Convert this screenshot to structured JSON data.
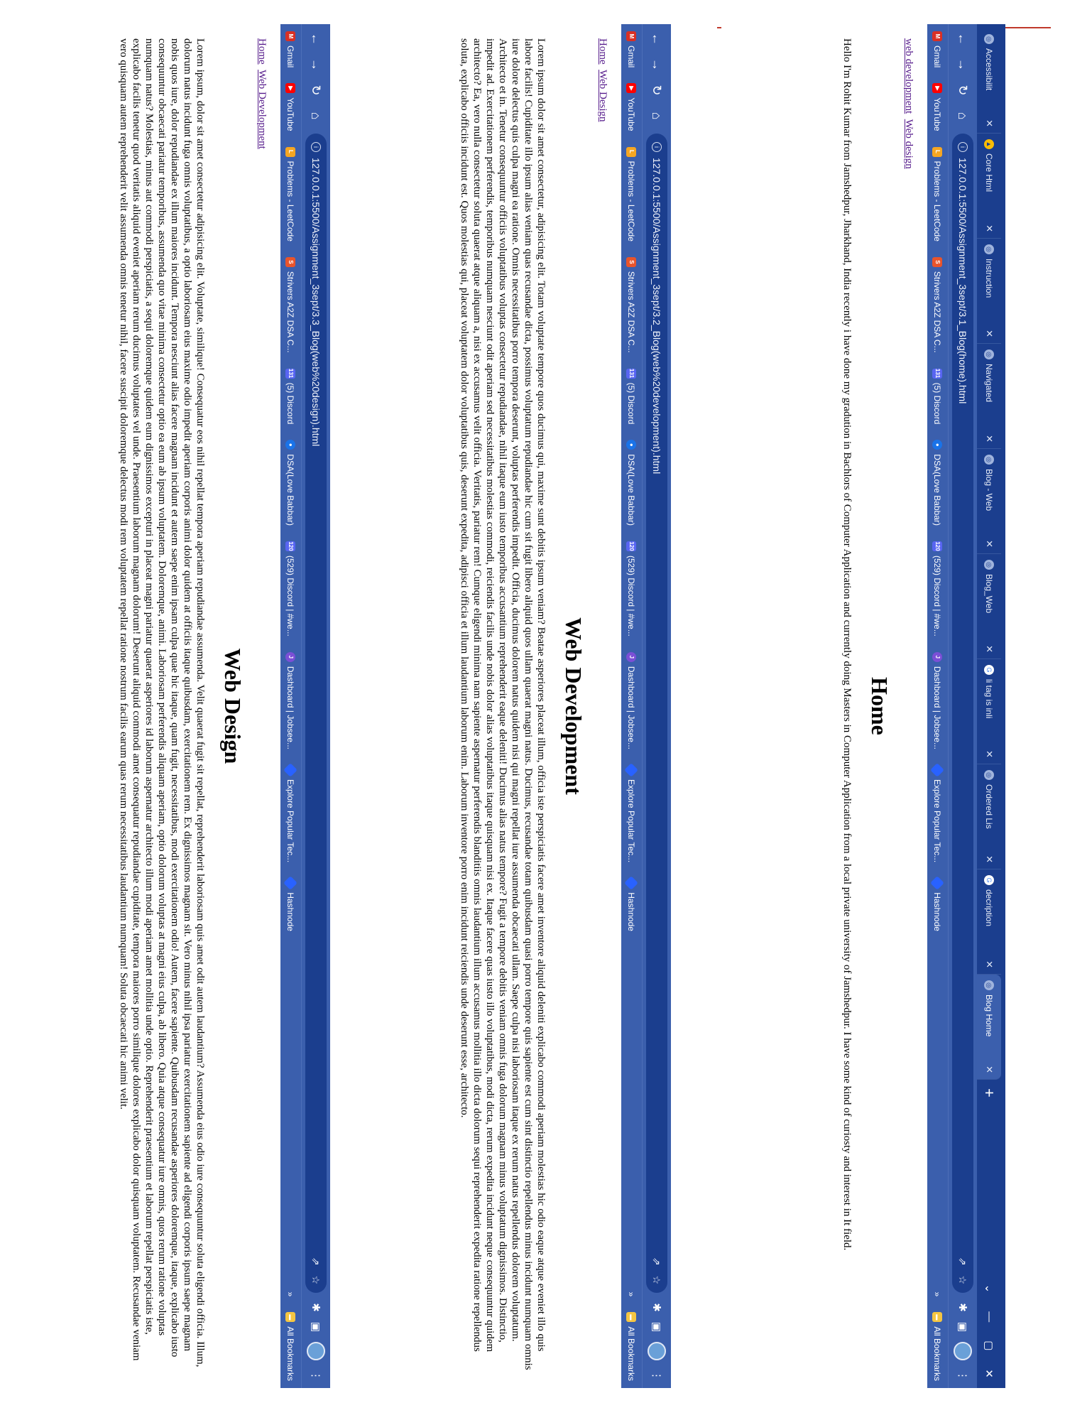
{
  "browser": {
    "tabs": [
      {
        "label": "Accessibilit"
      },
      {
        "label": "Core Html"
      },
      {
        "label": "Instruction"
      },
      {
        "label": "Navigated"
      },
      {
        "label": "Blog - Web"
      },
      {
        "label": "Blog_Web"
      },
      {
        "label": "li tag is inli"
      },
      {
        "label": "Ordered Lis"
      },
      {
        "label": "decription"
      },
      {
        "label": "Blog Home"
      }
    ],
    "bookmarks": [
      {
        "label": "Gmail",
        "color": "#d93025",
        "icon": "gmail-icon"
      },
      {
        "label": "YouTube",
        "color": "#ff0000",
        "icon": "youtube-icon"
      },
      {
        "label": "Problems - LeetCode",
        "color": "#f5a623",
        "icon": "leetcode-icon"
      },
      {
        "label": "Strivers A2Z DSA C...",
        "color": "#e8542c",
        "icon": "striver-icon"
      },
      {
        "label": "(5) Discord",
        "color": "#5865f2",
        "icon": "discord-icon",
        "badge": "131"
      },
      {
        "label": "DSA(Love Babbar)",
        "color": "#1a73e8",
        "icon": "chrome-icon"
      },
      {
        "label": "(529) Discord | #we...",
        "color": "#5865f2",
        "icon": "discord-icon",
        "badge": "120"
      },
      {
        "label": "Dashboard | Jobsee...",
        "color": "#7b4fd6",
        "icon": "jobseeker-icon"
      },
      {
        "label": "Explore Popular Tec...",
        "color": "#2962ff",
        "icon": "hashnode-icon"
      },
      {
        "label": "Hashnode",
        "color": "#2962ff",
        "icon": "hashnode-icon"
      }
    ],
    "all_bookmarks": "All Bookmarks"
  },
  "home": {
    "url": "127.0.0.1:5500/Assignment_3sept/3.1_Blog(home).html",
    "links": [
      "web development",
      "Web design"
    ],
    "title": "Home",
    "body": "Hello I'm Rohit Kumar from Jamshedpur, Jharkhand, India recently i have done my gradution in Bachlors of Computer Application and currently doing Masters in Computer Application from a local private university of Jamshedpur. I have some kind of curiosty and interest in It field."
  },
  "dev": {
    "url": "127.0.0.1:5500/Assignment_3sept/3.2_Blog(web%20development).html",
    "links": [
      "Home",
      "Web Design"
    ],
    "title": "Web Development",
    "body": "Lorem ipsum dolor sit amet consectetur, adipisicing elit. Totam voluptate tempore quos ducimus qui, maxime sunt debitis ipsum veniam? Beatae asperiores placeat illum, officia iste perspiciatis facere amet inventore aliquid deleniti explicabo commodi aperiam molestias hic odio eaque atque eveniet illo quis labore facilis! Cupiditate illo ipsum alias veniam quas recusandae dicta, possimus voluptatum repudiandae hic cum sit fugit libero aliquid quos ullam quaerat magni natus. Ducimus, recusandae totam quibusdam quasi porro tempore quis sapiente est cum sint distinctio repellendus minus incidunt numquam omnis iure dolore delectus quis culpa magni ea ratione. Omnis necessitatibus porro tempora deserunt, voluptas perferendis impedit. Officia, ducimus dolorem natus quidem nisi qui magni repellat iure assumenda obcaecati ullam. Saepe culpa nisi laboriosam itaque ex rerum natus repellendus dolorem voluptatum. Architecto et in. Tenetur consequuntur officiis voluptatibus voluptas consectetur repudiandae, nihil itaque eum iusto temporibus accusantium reprehenderit eaque deleniti! Ducimus alias natus tempore? Fugit a tempore debitis veniam omnis fuga dolorum magnam minus voluptatum dignissimos. Distinctio, impedit ad. Exercitationem perferendis, temporibus numquam nesciunt odit aperiam sed necessitatibus molestias commodi, reiciendis facilis unde nobis dolor alias voluptatibus itaque quisquam nisi ex. Itaque facere quas iusto illo voluptatibus, modi dicta, rerum expedita incidunt neque consequuntur quidem architecto? Ea, vero nulla consectetur soluta quaerat atque aliquam a, nisi ex accusamus velit officia. Veritatis, pariatur rem! Cumque eligendi minima nam sapiente aspernatur perferendis blanditiis omnis laudantium illum accusamus mollitia illo dicta dolorum sequi reprehenderit expedita ratione repellendus soluta, explicabo officiis incidunt est. Quos molestias qui, placeat voluptatem dolor voluptatibus quis, deserunt expedita, adipisci officia et illum laudantium laborum enim. Laborum inventore porro enim incidunt reiciendis unde deserunt esse, architecto."
  },
  "design": {
    "url": "127.0.0.1:5500/Assignment_3sept/3.3_Blog(web%20design).html",
    "links": [
      "Home",
      "Web Development"
    ],
    "title": "Web Design",
    "body": "Lorem ipsum, dolor sit amet consectetur adipisicing elit. Voluptate, similique! Consequatur eos nihil repellat tempora aperiam repudiandae assumenda. Velit quaerat fugit sit repellat, reprehenderit laboriosam quis amet odit autem laudantium? Assumenda eius odio iure consequuntur soluta eligendi officia. Illum, dolorum natus incidunt fuga omnis voluptatibus, a optio laboriosam eius maxime odio impedit aperiam corporis animi dolor quidem at officiis itaque quibusdam, exercitationem rem. Ex dignissimos magnam sit. Vero minus nihil ipsa pariatur exercitationem sapiente ad eligendi corporis ipsum saepe magnam nobis quos iure, dolor repudiandae ex illum maiores incidunt. Tempora nesciunt alias facere magnam incidunt et autem saepe enim ipsam culpa quae hic itaque, quam fugit, necessitatibus, modi exercitationem odio! Autem, facere sapiente. Quibusdam recusandae asperiores doloremque, itaque, explicabo iusto consequuntur obcaecati pariatur temporibus, assumenda quo vitae minima consectetur optio ea eum ab ipsum voluptatem. Doloremque, animi. Laboriosam perferendis aliquam aperiam, optio dolorum voluptas at magni eius culpa, ab libero. Quia atque consequatur iure omnis, quos rerum ratione voluptas numquam natus? Molestias, minus aut commodi perspiciatis, a sequi doloremque quidem eum dignissimos excepturi in placeat magni pariatur quaerat asperiores id laborum aspernatur architecto illum modi aperiam amet mollitia unde optio. Reprehenderit praesentium et laborum repellat perspiciatis iste, explicabo facilis tenetur quod veritatis aliquid eveniet aperiam rerum ducimus voluptates vel unde. Praesentium laborum magnam dolorum! Deserunt aliquid commodi amet consequatur repudiandae cupiditate, tempora maiores porro similique dolores explicabo dolor quisquam voluptatem. Recusandae veniam vero quisquam autem reprehenderit velit assumenda omnis tenetur nihil, facere suscipit doloremque delectus modi rem voluptatem repellat ratione nostrum facilis earum quas rerum necessitatibus laudantium numquam! Soluta obcaecati hic animi velit."
  }
}
